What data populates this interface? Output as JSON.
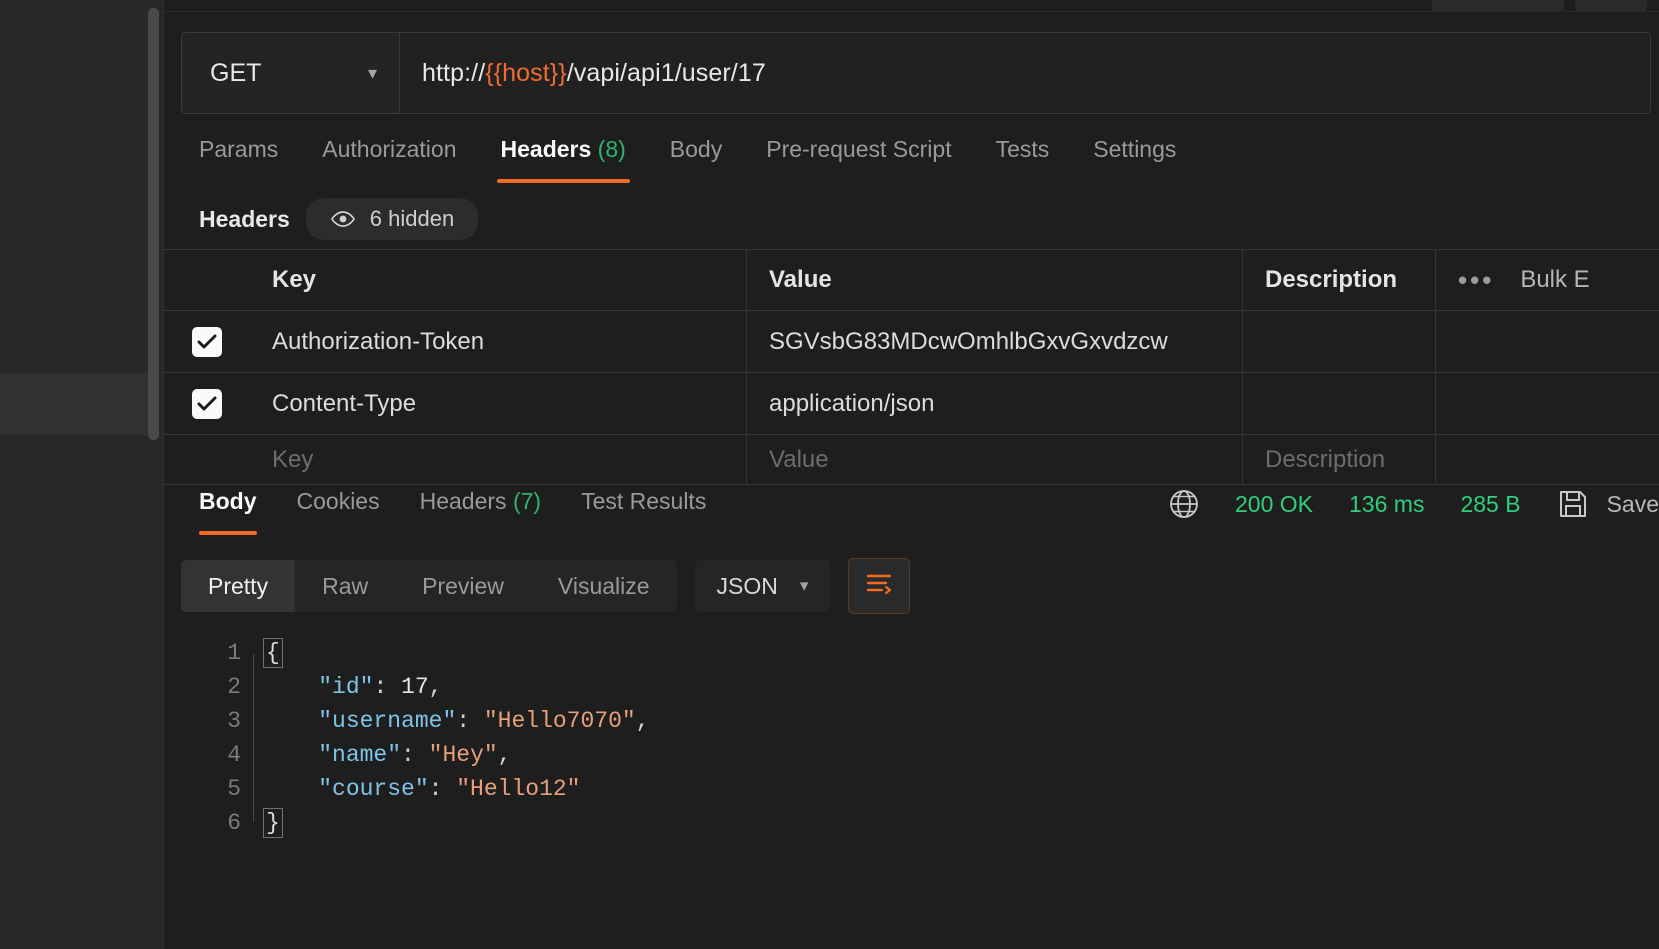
{
  "sidebar": {
    "scrollbar": "vertical-scrollbar"
  },
  "request": {
    "method": "GET",
    "url_prefix": "http://",
    "url_variable": "{{host}}",
    "url_suffix": "/vapi/api1/user/17",
    "url_full": "http://{{host}}/vapi/api1/user/17",
    "tabs": [
      {
        "label": "Params",
        "count": "",
        "active": false
      },
      {
        "label": "Authorization",
        "count": "",
        "active": false
      },
      {
        "label": "Headers",
        "count": "(8)",
        "active": true
      },
      {
        "label": "Body",
        "count": "",
        "active": false
      },
      {
        "label": "Pre-request Script",
        "count": "",
        "active": false
      },
      {
        "label": "Tests",
        "count": "",
        "active": false
      },
      {
        "label": "Settings",
        "count": "",
        "active": false
      }
    ]
  },
  "headers_section": {
    "title": "Headers",
    "hidden_label": "6 hidden",
    "columns": {
      "key": "Key",
      "value": "Value",
      "description": "Description"
    },
    "actions": {
      "dots": "•••",
      "bulk_edit": "Bulk E"
    },
    "rows": [
      {
        "checked": true,
        "key": "Authorization-Token",
        "value": "SGVsbG83MDcwOmhlbGxvGxvdzcw",
        "description": ""
      },
      {
        "checked": true,
        "key": "Content-Type",
        "value": "application/json",
        "description": ""
      }
    ],
    "placeholder_row": {
      "key": "Key",
      "value": "Value",
      "description": "Description"
    }
  },
  "response": {
    "tabs": [
      {
        "label": "Body",
        "count": "",
        "active": true
      },
      {
        "label": "Cookies",
        "count": "",
        "active": false
      },
      {
        "label": "Headers",
        "count": "(7)",
        "active": false
      },
      {
        "label": "Test Results",
        "count": "",
        "active": false
      }
    ],
    "status": {
      "globe_icon": "globe-icon",
      "code": "200 OK",
      "time": "136 ms",
      "size": "285 B",
      "save_icon": "save-icon",
      "save_label": "Save"
    },
    "format_tabs": [
      {
        "label": "Pretty",
        "active": true
      },
      {
        "label": "Raw",
        "active": false
      },
      {
        "label": "Preview",
        "active": false
      },
      {
        "label": "Visualize",
        "active": false
      }
    ],
    "language": "JSON",
    "wrap_icon": "wrap-text-icon",
    "line_numbers": [
      "1",
      "2",
      "3",
      "4",
      "5",
      "6"
    ],
    "body_lines": [
      {
        "n": "1",
        "open_brace": "{"
      },
      {
        "n": "2",
        "key": "\"id\"",
        "sep": ": ",
        "value": "17",
        "value_type": "number",
        "comma": ","
      },
      {
        "n": "3",
        "key": "\"username\"",
        "sep": ": ",
        "value": "\"Hello7070\"",
        "value_type": "string",
        "comma": ","
      },
      {
        "n": "4",
        "key": "\"name\"",
        "sep": ": ",
        "value": "\"Hey\"",
        "value_type": "string",
        "comma": ","
      },
      {
        "n": "5",
        "key": "\"course\"",
        "sep": ": ",
        "value": "\"Hello12\"",
        "value_type": "string",
        "comma": ""
      },
      {
        "n": "6",
        "close_brace": "}"
      }
    ]
  },
  "colors": {
    "accent": "#f26b21",
    "success": "#2fd07b",
    "bg": "#1e1e1e",
    "panel": "#282828",
    "key_blue": "#7fc4e8",
    "string_orange": "#e8a07a"
  }
}
